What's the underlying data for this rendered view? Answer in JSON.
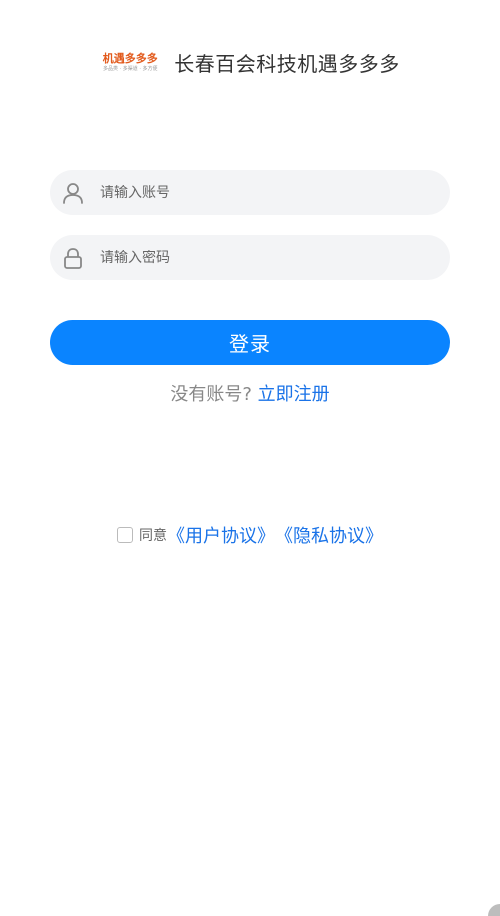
{
  "header": {
    "logo_main": "机遇多多多",
    "logo_sub": "多品类 · 多渠道 · 多方便",
    "title": "长春百会科技机遇多多多"
  },
  "form": {
    "account_placeholder": "请输入账号",
    "password_placeholder": "请输入密码",
    "login_label": "登录"
  },
  "register": {
    "question": "没有账号?",
    "link": "立即注册"
  },
  "agreement": {
    "checked": false,
    "prefix": "同意",
    "user_agreement": "《用户协议》",
    "privacy_policy": "《隐私协议》"
  },
  "colors": {
    "primary": "#0a84ff",
    "link": "#1a73e8",
    "field_bg": "#f3f4f6",
    "brand_orange": "#e25a1c"
  },
  "icons": [
    "user-icon",
    "lock-icon"
  ]
}
